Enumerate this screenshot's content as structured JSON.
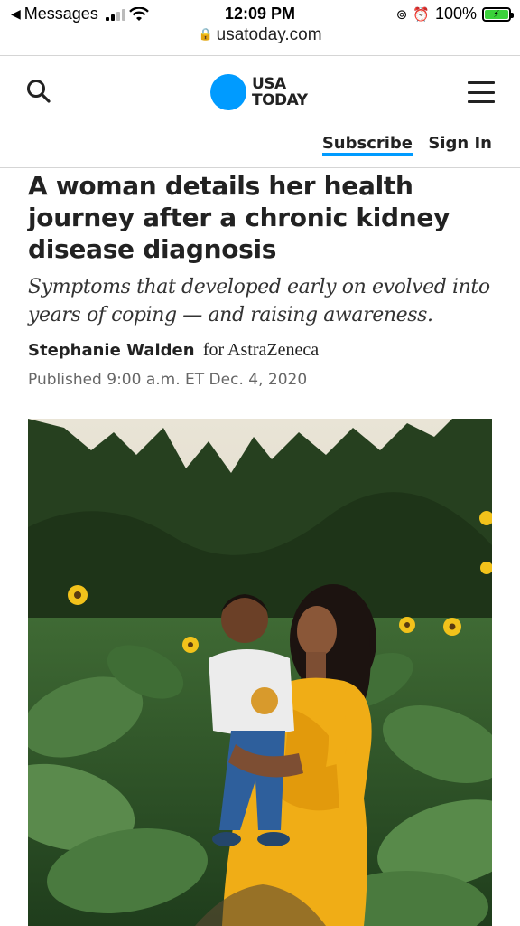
{
  "status_bar": {
    "back_label": "Messages",
    "time": "12:09 PM",
    "battery": "100%"
  },
  "url_bar": {
    "domain": "usatoday.com"
  },
  "header": {
    "logo_line1": "USA",
    "logo_line2": "TODAY",
    "subscribe_label": "Subscribe",
    "signin_label": "Sign In",
    "accent_color": "#009bff"
  },
  "article": {
    "headline": "A woman details her health journey after a chronic kidney disease diagnosis",
    "dek": "Symptoms that developed early on evolved into years of coping — and raising awareness.",
    "author": "Stephanie Walden",
    "sponsor": "for AstraZeneca",
    "published": "Published 9:00 a.m. ET Dec. 4, 2020"
  },
  "icons": {
    "search": "search-icon",
    "menu": "hamburger-menu-icon",
    "lock": "lock-icon",
    "wifi": "wifi-icon"
  }
}
